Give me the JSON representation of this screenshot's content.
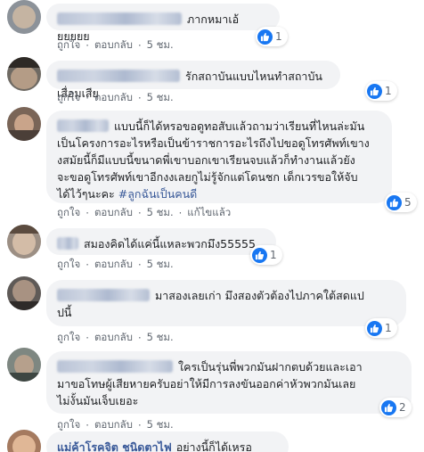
{
  "comments": [
    {
      "text": "ภากหมาเอ้ยยยยย",
      "likes": "1",
      "actions": {
        "like": "ถูกใจ",
        "reply": "ตอบกลับ",
        "time": "5 ชม."
      }
    },
    {
      "text": "รักสถาบันแบบไหนทำสถาบันเสื่อมเสีย",
      "likes": "1",
      "actions": {
        "like": "ถูกใจ",
        "reply": "ตอบกลับ",
        "time": "5 ชม."
      }
    },
    {
      "text_lines": [
        "แบบนี้ก็ได้หรอขอดูทอสับแล้วถามว่าเรียนที่ไหนล่ะมัน",
        "เป็นโครงการอะไรหรือเป็นข้าราชการอะไรถึงไปขอดูโทรศัพท์เขาง",
        "งสมัยนี้ก็มีแบบนี้ขนาดพี่เขาบอกเขาเรียนจบแล้วก็ทำงานแล้วยัง",
        "จะขอดูโทรศัพท์เขาอีกงงเลยกูไม่รู้จักแต่โดนชก เด็กเวรขอให้จับ",
        "ได้ไว้ๆนะคะ"
      ],
      "hashtag": "#ลูกฉันเป็นคนดี",
      "likes": "5",
      "actions": {
        "like": "ถูกใจ",
        "reply": "ตอบกลับ",
        "time": "5 ชม.",
        "edited": "แก้ไขแล้ว"
      }
    },
    {
      "text": "สมองคิดได้แค่นี้แหละพวกมึง55555",
      "likes": "1",
      "actions": {
        "like": "ถูกใจ",
        "reply": "ตอบกลับ",
        "time": "5 ชม."
      }
    },
    {
      "text_lines": [
        "มาสองเลยเก่า มึงสองตัวต้องไปภาคใต้สดแป",
        "ปนี้"
      ],
      "likes": "1",
      "actions": {
        "like": "ถูกใจ",
        "reply": "ตอบกลับ",
        "time": "5 ชม."
      }
    },
    {
      "text_lines": [
        "ใครเป็นรุ่นพี่พวกมันฝากตบด้วยและเอา",
        "มาขอโทษผู้เสียหายครับอย่าให้มีการลงขันออกค่าหัวพวกมันเลย",
        "ไม่งั้นมันเจ็บเยอะ"
      ],
      "likes": "2",
      "actions": {
        "like": "ถูกใจ",
        "reply": "ตอบกลับ",
        "time": "5 ชม."
      }
    },
    {
      "name": "แม่ค้าโรคจิต ชนิดตาไฟ",
      "text": "อย่างนี้ก็ได้เหรอ"
    }
  ],
  "colors": {
    "link": "#385898",
    "bubble": "#f2f3f5",
    "like": "#1877f2",
    "meta": "#606770"
  },
  "icons": {
    "reaction": "like-thumb-icon"
  }
}
